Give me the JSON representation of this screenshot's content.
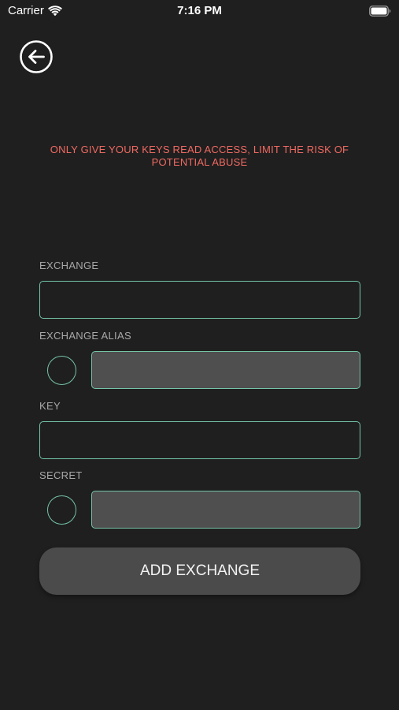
{
  "status_bar": {
    "carrier": "Carrier",
    "time": "7:16 PM"
  },
  "warning": {
    "text": "ONLY GIVE YOUR KEYS READ ACCESS, LIMIT THE RISK OF POTENTIAL ABUSE",
    "color": "#f06a62"
  },
  "form": {
    "exchange": {
      "label": "EXCHANGE",
      "value": ""
    },
    "exchange_alias": {
      "label": "EXCHANGE ALIAS",
      "value": "",
      "toggle_selected": false
    },
    "key": {
      "label": "KEY",
      "value": ""
    },
    "secret": {
      "label": "SECRET",
      "value": "",
      "toggle_selected": false
    },
    "submit_label": "ADD EXCHANGE"
  },
  "colors": {
    "background": "#1f1f1f",
    "accent_border": "#74c4a6",
    "button_bg": "#4b4b4b",
    "filled_input_bg": "#4f4f4f"
  },
  "icons": {
    "back": "arrow-left-circle-icon",
    "wifi": "wifi-icon",
    "battery": "battery-icon"
  }
}
